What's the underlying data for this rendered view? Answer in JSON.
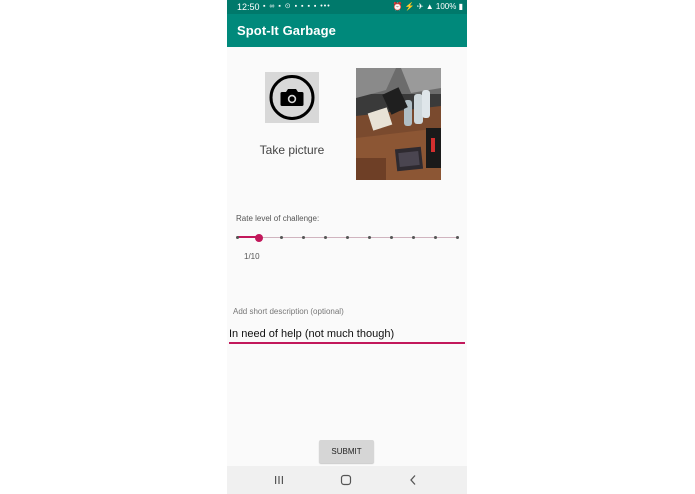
{
  "status_bar": {
    "time": "12:50",
    "left_icons": "▪ ∞ ▪ ⊙ ▪ ▪ ▪ ▪ •••",
    "right_icons": "⏰ ⚡ ✈ ▲ 100% ▮",
    "battery": "100%"
  },
  "app_bar": {
    "title": "Spot-It Garbage",
    "color": "#00897b"
  },
  "camera": {
    "icon": "camera-icon",
    "label": "Take picture"
  },
  "photo": {
    "description": "thumbnail of captured photo"
  },
  "challenge": {
    "label": "Rate level of challenge:",
    "value": 1,
    "max": 10,
    "value_text": "1/10",
    "accent": "#c2185b"
  },
  "description": {
    "label": "Add short description (optional)",
    "value": "In need of help (not much though)"
  },
  "submit": {
    "label": "SUBMIT"
  },
  "nav": {
    "recent_icon": "recent-apps-icon",
    "home_icon": "home-icon",
    "back_icon": "back-icon"
  }
}
